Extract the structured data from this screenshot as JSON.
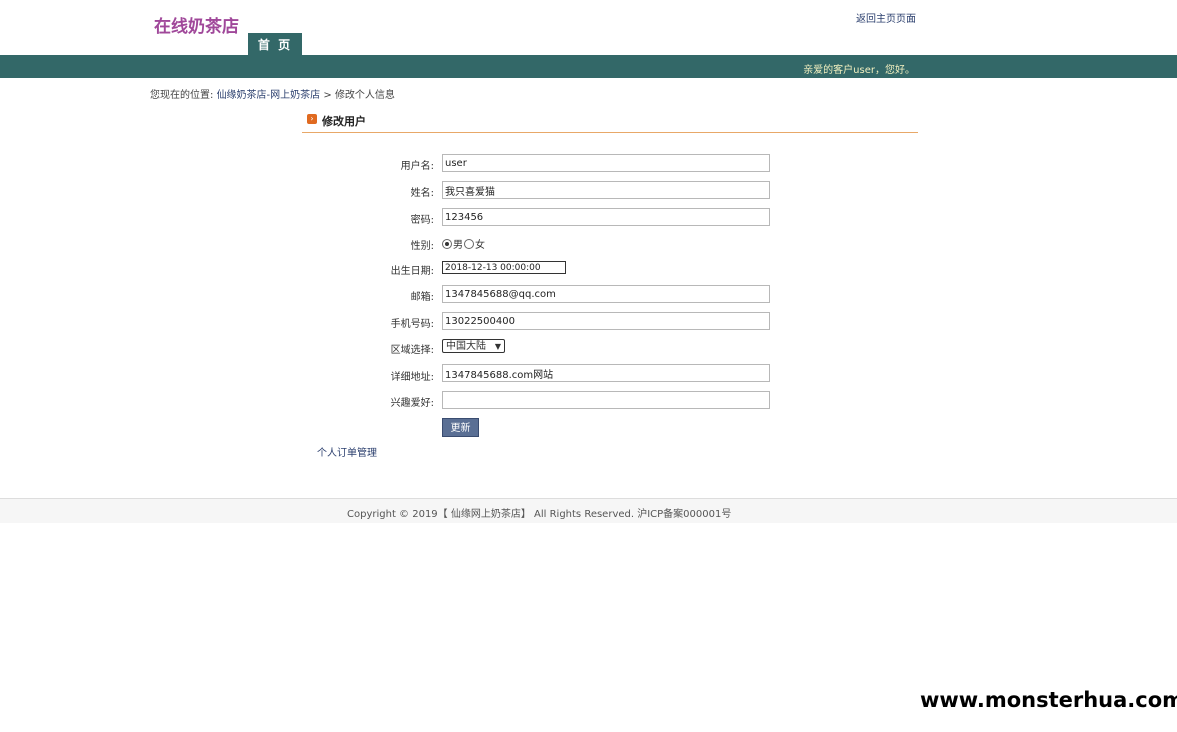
{
  "header": {
    "logo": "在线奶茶店",
    "back_home_link": "返回主页页面",
    "nav_tab": "首 页",
    "greeting": "亲爱的客户user，您好。"
  },
  "breadcrumb": {
    "prefix": "您现在的位置:",
    "site_link": "仙缘奶茶店-网上奶茶店",
    "separator": ">",
    "current": "修改个人信息"
  },
  "section": {
    "title": "修改用户"
  },
  "form": {
    "username": {
      "label": "用户名:",
      "value": "user"
    },
    "name": {
      "label": "姓名:",
      "value": "我只喜爱猫"
    },
    "password": {
      "label": "密码:",
      "value": "123456"
    },
    "gender": {
      "label": "性别:",
      "male": "男",
      "female": "女",
      "selected": "男"
    },
    "birthday": {
      "label": "出生日期:",
      "value": "2018-12-13 00:00:00"
    },
    "email": {
      "label": "邮箱:",
      "value": "1347845688@qq.com"
    },
    "phone": {
      "label": "手机号码:",
      "value": "13022500400"
    },
    "region": {
      "label": "区域选择:",
      "selected": "中国大陆"
    },
    "address": {
      "label": "详细地址:",
      "value": "1347845688.com网站"
    },
    "hobby": {
      "label": "兴趣爱好:",
      "value": ""
    },
    "submit_label": "更新"
  },
  "order_link": "个人订单管理",
  "footer": {
    "copyright": "Copyright © 2019【 仙缘网上奶茶店】 All Rights Reserved. 沪ICP备案000001号"
  },
  "watermark": "www.monsterhua.com",
  "colors": {
    "nav_bg": "#336868",
    "logo": "#a0489a",
    "accent_line": "#e8a868",
    "button": "#5a6f94"
  }
}
